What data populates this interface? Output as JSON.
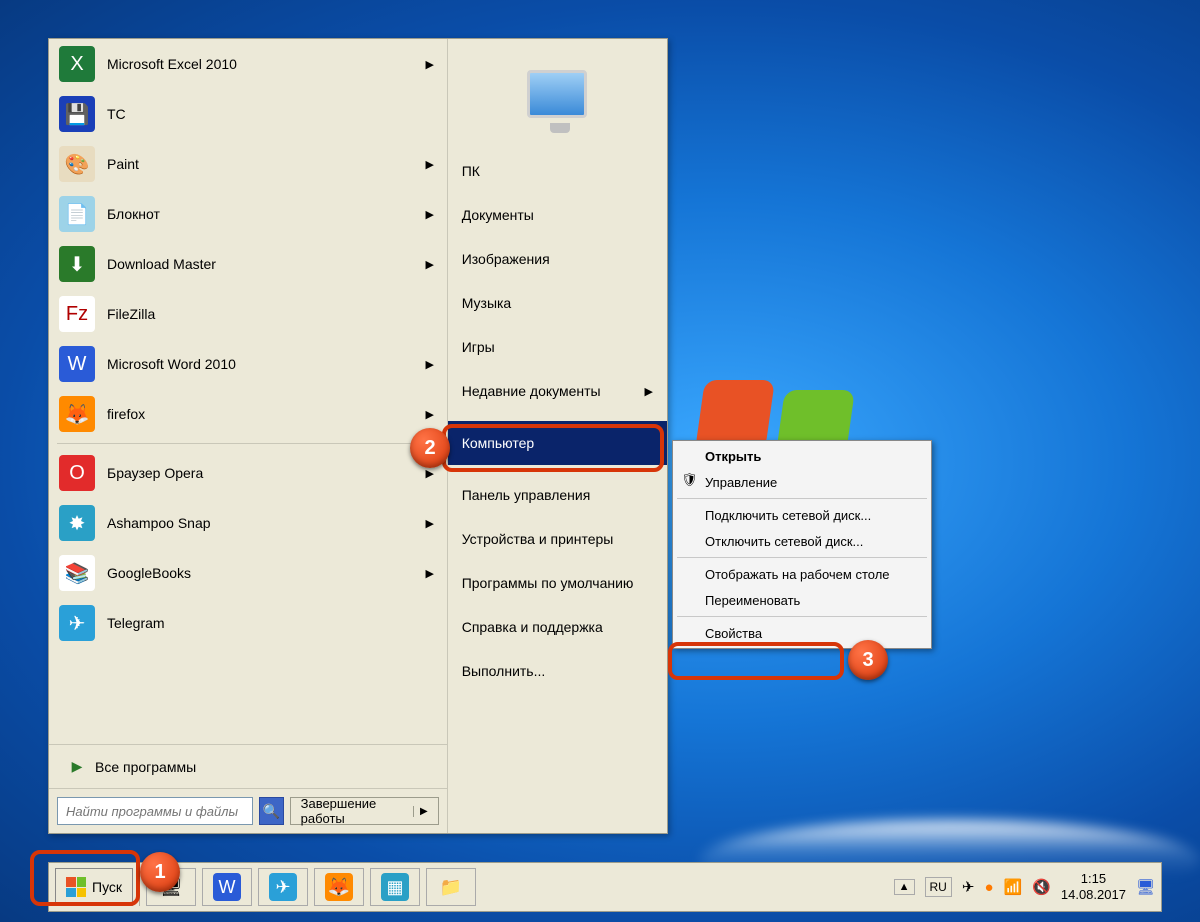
{
  "startmenu": {
    "programs": [
      {
        "label": "Microsoft Excel 2010",
        "icon_bg": "#1f7a3a",
        "glyph": "X",
        "has_submenu": true,
        "name": "prog-excel"
      },
      {
        "label": "TC",
        "icon_bg": "#1a3fb8",
        "glyph": "💾",
        "has_submenu": false,
        "name": "prog-tc"
      },
      {
        "label": "Paint",
        "icon_bg": "#e8dcc0",
        "glyph": "🎨",
        "has_submenu": true,
        "name": "prog-paint"
      },
      {
        "label": "Блокнот",
        "icon_bg": "#9dd3e8",
        "glyph": "📄",
        "has_submenu": true,
        "name": "prog-notepad"
      },
      {
        "label": "Download Master",
        "icon_bg": "#2a7a2a",
        "glyph": "⬇",
        "has_submenu": true,
        "name": "prog-dm"
      },
      {
        "label": "FileZilla",
        "icon_bg": "#ffffff",
        "glyph": "Fz",
        "glyph_color": "#b00000",
        "has_submenu": false,
        "name": "prog-filezilla"
      },
      {
        "label": "Microsoft Word 2010",
        "icon_bg": "#2a5bd7",
        "glyph": "W",
        "has_submenu": true,
        "name": "prog-word"
      },
      {
        "label": "firefox",
        "icon_bg": "#ff8a00",
        "glyph": "🦊",
        "has_submenu": true,
        "name": "prog-firefox"
      }
    ],
    "programs2": [
      {
        "label": "Браузер Opera",
        "icon_bg": "#e22b2b",
        "glyph": "O",
        "has_submenu": true,
        "name": "prog-opera"
      },
      {
        "label": "Ashampoo Snap",
        "icon_bg": "#2aa0c6",
        "glyph": "✸",
        "has_submenu": true,
        "name": "prog-snap"
      },
      {
        "label": "GoogleBooks",
        "icon_bg": "#ffffff",
        "glyph": "📚",
        "has_submenu": true,
        "name": "prog-gbooks"
      },
      {
        "label": "Telegram",
        "icon_bg": "#2aa0d8",
        "glyph": "✈",
        "has_submenu": false,
        "name": "prog-telegram"
      }
    ],
    "all_programs": "Все программы",
    "search_placeholder": "Найти программы и файлы",
    "shutdown": "Завершение работы",
    "right": [
      {
        "label": "ПК",
        "name": "r-pc"
      },
      {
        "label": "Документы",
        "name": "r-documents"
      },
      {
        "label": "Изображения",
        "name": "r-images"
      },
      {
        "label": "Музыка",
        "name": "r-music"
      },
      {
        "label": "Игры",
        "name": "r-games"
      },
      {
        "label": "Недавние документы",
        "has_submenu": true,
        "name": "r-recent"
      },
      {
        "label": "Компьютер",
        "selected": true,
        "name": "r-computer"
      },
      {
        "label": "Панель управления",
        "name": "r-controlpanel"
      },
      {
        "label": "Устройства и принтеры",
        "name": "r-devices"
      },
      {
        "label": "Программы по умолчанию",
        "name": "r-defaults"
      },
      {
        "label": "Справка и поддержка",
        "name": "r-help"
      },
      {
        "label": "Выполнить...",
        "name": "r-run"
      }
    ]
  },
  "context_menu": {
    "items": [
      {
        "label": "Открыть",
        "bold": true,
        "name": "ctx-open"
      },
      {
        "label": "Управление",
        "shield": true,
        "name": "ctx-manage"
      },
      {
        "sep": true
      },
      {
        "label": "Подключить сетевой диск...",
        "name": "ctx-map-drive"
      },
      {
        "label": "Отключить сетевой диск...",
        "name": "ctx-unmap-drive"
      },
      {
        "sep": true
      },
      {
        "label": "Отображать на рабочем столе",
        "name": "ctx-show-desktop"
      },
      {
        "label": "Переименовать",
        "name": "ctx-rename"
      },
      {
        "sep": true
      },
      {
        "label": "Свойства",
        "name": "ctx-properties"
      }
    ]
  },
  "taskbar": {
    "start": "Пуск",
    "icons": [
      {
        "glyph": "🖥",
        "name": "task-explorer"
      },
      {
        "glyph": "W",
        "bg": "#2a5bd7",
        "name": "task-word"
      },
      {
        "glyph": "✈",
        "bg": "#2aa0d8",
        "name": "task-telegram"
      },
      {
        "glyph": "🦊",
        "bg": "#ff8a00",
        "name": "task-firefox"
      },
      {
        "glyph": "▦",
        "bg": "#2aa0c6",
        "name": "task-snap"
      },
      {
        "glyph": "📁",
        "name": "task-folder"
      }
    ],
    "lang": "RU",
    "time": "1:15",
    "date": "14.08.2017"
  },
  "markers": {
    "m1": "1",
    "m2": "2",
    "m3": "3"
  }
}
